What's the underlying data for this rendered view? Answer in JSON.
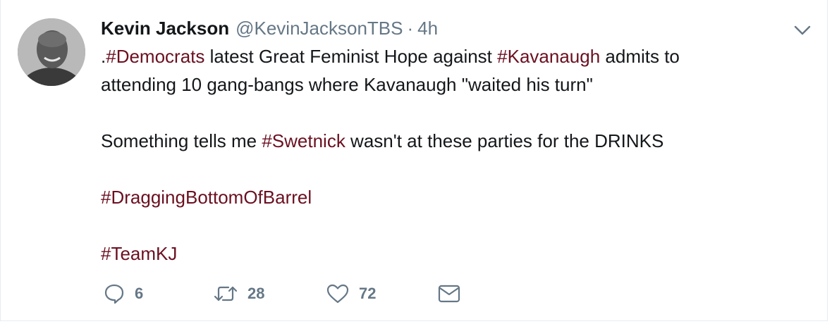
{
  "tweet": {
    "author_name": "Kevin Jackson",
    "author_handle": "@KevinJacksonTBS",
    "separator": "·",
    "time": "4h",
    "line1": {
      "prefix": ".",
      "tag1": "#Democrats",
      "mid": " latest Great Feminist Hope against ",
      "tag2": "#Kavanaugh",
      "suffix": " admits to"
    },
    "line2": "attending 10 gang-bangs where Kavanaugh \"waited his turn\"",
    "line3": {
      "prefix": "Something tells me ",
      "tag": "#Swetnick",
      "suffix": " wasn't at these parties for the DRINKS"
    },
    "tag_line4": "#DraggingBottomOfBarrel",
    "tag_line5": "#TeamKJ"
  },
  "actions": {
    "replies": "6",
    "retweets": "28",
    "likes": "72"
  },
  "icons": [
    "chevron-down-icon",
    "reply-icon",
    "retweet-icon",
    "heart-icon",
    "envelope-icon"
  ],
  "colors": {
    "hashtag": "#6b1020",
    "text": "#14171a",
    "secondary": "#657786"
  }
}
